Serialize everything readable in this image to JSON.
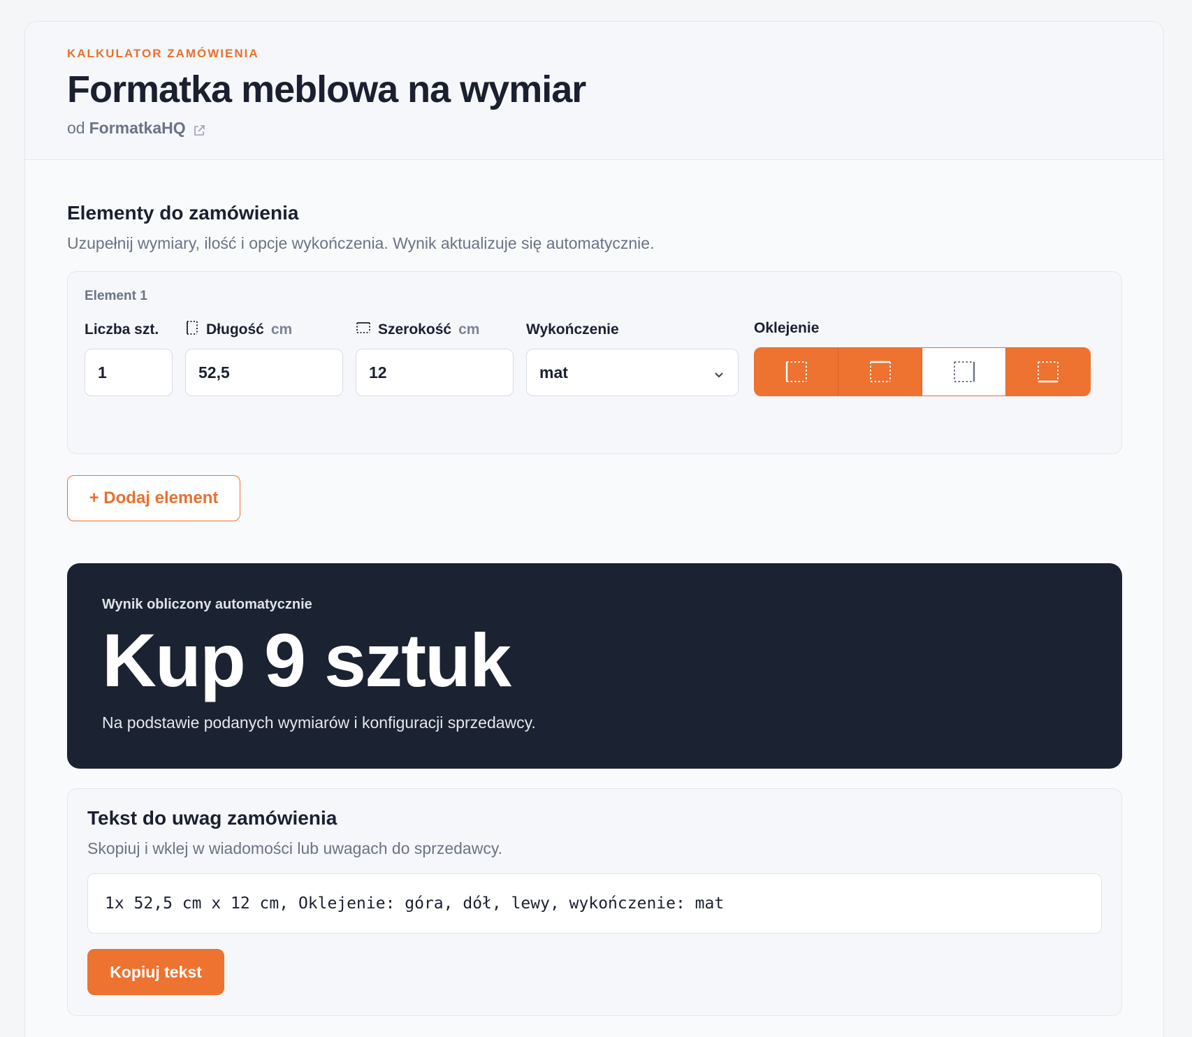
{
  "header": {
    "eyebrow": "KALKULATOR ZAMÓWIENIA",
    "title": "Formatka meblowa na wymiar",
    "by_prefix": "od",
    "brand": "FormatkaHQ",
    "brand_icon": "external-link-icon"
  },
  "section": {
    "title": "Elementy do zamówienia",
    "subtitle": "Uzupełnij wymiary, ilość i opcje wykończenia. Wynik aktualizuje się automatycznie."
  },
  "element": {
    "label": "Element 1",
    "quantity": {
      "label": "Liczba szt.",
      "value": "1"
    },
    "length": {
      "label": "Długość",
      "unit": "cm",
      "value": "52,5",
      "icon": "length-dimension-icon"
    },
    "width": {
      "label": "Szerokość",
      "unit": "cm",
      "value": "12",
      "icon": "width-dimension-icon"
    },
    "finish": {
      "label": "Wykończenie",
      "value": "mat",
      "icon": "chevron-down-icon"
    },
    "edging": {
      "label": "Oklejenie",
      "edges": [
        {
          "name": "lewy",
          "active": true
        },
        {
          "name": "góra",
          "active": true
        },
        {
          "name": "prawy",
          "active": false
        },
        {
          "name": "dół",
          "active": true
        }
      ]
    }
  },
  "add_button": "+ Dodaj element",
  "result": {
    "eyebrow": "Wynik obliczony automatycznie",
    "headline": "Kup 9 sztuk",
    "subtitle": "Na podstawie podanych wymiarów i konfiguracji sprzedawcy."
  },
  "notes": {
    "title": "Tekst do uwag zamówienia",
    "subtitle": "Skopiuj i wklej w wiadomości lub uwagach do sprzedawcy.",
    "text": "1x 52,5 cm x 12 cm, Oklejenie: góra, dół, lewy, wykończenie: mat",
    "copy_button": "Kopiuj tekst"
  },
  "colors": {
    "accent": "#ee7230",
    "dark_panel": "#1b2231",
    "text": "#1b2030",
    "muted": "#6b7385"
  }
}
